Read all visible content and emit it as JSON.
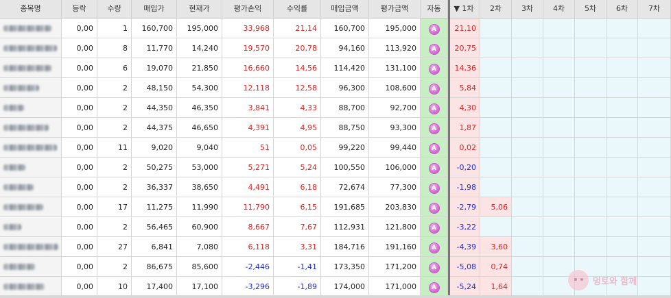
{
  "columns": [
    "종목명",
    "등락",
    "수량",
    "매입가",
    "현재가",
    "평가손익",
    "수익률",
    "매입금액",
    "평가금액",
    "자동",
    "▼ 1차",
    "2차",
    "3차",
    "4차",
    "5차",
    "6차",
    "7차"
  ],
  "auto_badge": "A",
  "rows": [
    {
      "change": "0,00",
      "qty": "1",
      "buy_price": "160,700",
      "cur_price": "195,000",
      "pnl": "33,968",
      "rate": "21,14",
      "buy_amt": "160,700",
      "eval_amt": "195,000",
      "s1": "21,10",
      "s2": "",
      "sign": "pos",
      "s2sign": ""
    },
    {
      "change": "0,00",
      "qty": "8",
      "buy_price": "11,770",
      "cur_price": "14,240",
      "pnl": "19,570",
      "rate": "20,78",
      "buy_amt": "94,160",
      "eval_amt": "113,920",
      "s1": "20,75",
      "s2": "",
      "sign": "pos",
      "s2sign": ""
    },
    {
      "change": "0,00",
      "qty": "6",
      "buy_price": "19,070",
      "cur_price": "21,850",
      "pnl": "16,660",
      "rate": "14,56",
      "buy_amt": "114,420",
      "eval_amt": "131,100",
      "s1": "14,36",
      "s2": "",
      "sign": "pos",
      "s2sign": ""
    },
    {
      "change": "0,00",
      "qty": "2",
      "buy_price": "48,150",
      "cur_price": "54,300",
      "pnl": "12,118",
      "rate": "12,58",
      "buy_amt": "96,300",
      "eval_amt": "108,600",
      "s1": "5,84",
      "s2": "",
      "sign": "pos",
      "s2sign": ""
    },
    {
      "change": "0,00",
      "qty": "2",
      "buy_price": "44,350",
      "cur_price": "46,350",
      "pnl": "3,841",
      "rate": "4,33",
      "buy_amt": "88,700",
      "eval_amt": "92,700",
      "s1": "4,30",
      "s2": "",
      "sign": "pos",
      "s2sign": ""
    },
    {
      "change": "0,00",
      "qty": "2",
      "buy_price": "44,375",
      "cur_price": "46,650",
      "pnl": "4,391",
      "rate": "4,95",
      "buy_amt": "88,750",
      "eval_amt": "93,300",
      "s1": "1,87",
      "s2": "",
      "sign": "pos",
      "s2sign": ""
    },
    {
      "change": "0,00",
      "qty": "11",
      "buy_price": "9,020",
      "cur_price": "9,040",
      "pnl": "51",
      "rate": "0,05",
      "buy_amt": "99,220",
      "eval_amt": "99,440",
      "s1": "0,02",
      "s2": "",
      "sign": "pos",
      "s2sign": ""
    },
    {
      "change": "0,00",
      "qty": "2",
      "buy_price": "50,275",
      "cur_price": "53,000",
      "pnl": "5,271",
      "rate": "5,24",
      "buy_amt": "100,550",
      "eval_amt": "106,000",
      "s1": "-0,20",
      "s2": "",
      "sign": "pos",
      "s2sign": ""
    },
    {
      "change": "0,00",
      "qty": "2",
      "buy_price": "36,337",
      "cur_price": "38,650",
      "pnl": "4,491",
      "rate": "6,18",
      "buy_amt": "72,674",
      "eval_amt": "77,300",
      "s1": "-1,98",
      "s2": "",
      "sign": "pos",
      "s2sign": ""
    },
    {
      "change": "0,00",
      "qty": "17",
      "buy_price": "11,275",
      "cur_price": "11,990",
      "pnl": "11,790",
      "rate": "6,15",
      "buy_amt": "191,685",
      "eval_amt": "203,830",
      "s1": "-2,79",
      "s2": "5,06",
      "sign": "pos",
      "s2sign": "pos"
    },
    {
      "change": "0,00",
      "qty": "2",
      "buy_price": "56,465",
      "cur_price": "60,900",
      "pnl": "8,667",
      "rate": "7,67",
      "buy_amt": "112,931",
      "eval_amt": "121,800",
      "s1": "-3,22",
      "s2": "",
      "sign": "pos",
      "s2sign": ""
    },
    {
      "change": "0,00",
      "qty": "27",
      "buy_price": "6,841",
      "cur_price": "7,080",
      "pnl": "6,118",
      "rate": "3,31",
      "buy_amt": "184,716",
      "eval_amt": "191,160",
      "s1": "-4,39",
      "s2": "3,60",
      "sign": "pos",
      "s2sign": "pos"
    },
    {
      "change": "0,00",
      "qty": "2",
      "buy_price": "86,675",
      "cur_price": "85,600",
      "pnl": "-2,446",
      "rate": "-1,41",
      "buy_amt": "173,350",
      "eval_amt": "171,200",
      "s1": "-5,08",
      "s2": "0,74",
      "sign": "neg",
      "s2sign": "pos"
    },
    {
      "change": "0,00",
      "qty": "10",
      "buy_price": "17,400",
      "cur_price": "17,100",
      "pnl": "-3,296",
      "rate": "-1,89",
      "buy_amt": "174,000",
      "eval_amt": "171,000",
      "s1": "-5,24",
      "s2": "1,64",
      "sign": "neg",
      "s2sign": "pos"
    }
  ],
  "watermark": "멍토와 함께",
  "colors": {
    "profit": "#e01e1e",
    "loss": "#1e2ad0",
    "auto_bg": "#c8eec3",
    "stage_bg": "#eaf7fb",
    "stage_hit_bg": "#fde4e4"
  }
}
